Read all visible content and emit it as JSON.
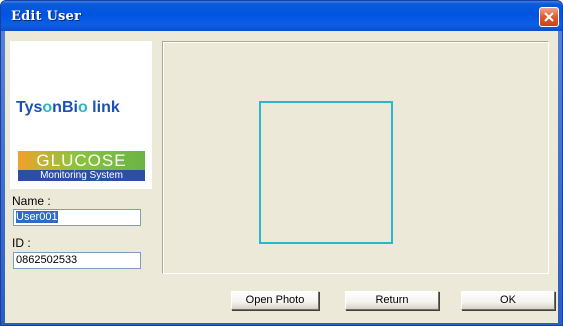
{
  "window": {
    "title": "Edit User"
  },
  "logos": {
    "brand_text_left": "Tys",
    "brand_text_o": "o",
    "brand_text_mid": "nBi",
    "brand_text_o2": "o",
    "brand_text_link": " link",
    "product_name": "GLUCOSE",
    "product_tagline": "Monitoring System"
  },
  "form": {
    "name_label": "Name :",
    "name_value": "User001",
    "id_label": "ID :",
    "id_value": "0862502533"
  },
  "buttons": {
    "open_photo": "Open Photo",
    "return": "Return",
    "ok": "OK"
  },
  "colors": {
    "title_bar": "#0054e3",
    "photo_frame": "#2ab7c7",
    "brand_blue": "#1d50b4",
    "selection": "#316ac5"
  },
  "icons": {
    "close": "close-icon"
  }
}
